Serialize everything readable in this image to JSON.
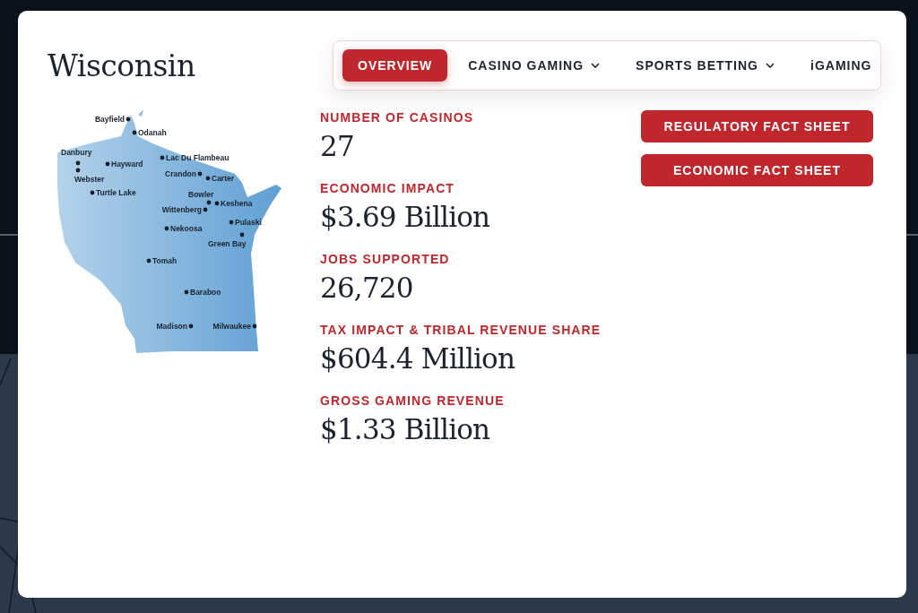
{
  "modal": {
    "title": "Wisconsin",
    "tabs": [
      {
        "label": "OVERVIEW",
        "selected": true,
        "dropdown": false
      },
      {
        "label": "CASINO GAMING",
        "selected": false,
        "dropdown": true
      },
      {
        "label": "SPORTS BETTING",
        "selected": false,
        "dropdown": true
      },
      {
        "label": "iGAMING",
        "selected": false,
        "dropdown": false
      }
    ],
    "map": {
      "cities": [
        "Bayfield",
        "Odanah",
        "Danbury",
        "Webster",
        "Hayward",
        "Turtle Lake",
        "Lac Du Flambeau",
        "Crandon",
        "Carter",
        "Bowler",
        "Keshena",
        "Wittenberg",
        "Pulaski",
        "Green Bay",
        "Nekoosa",
        "Tomah",
        "Baraboo",
        "Madison",
        "Milwaukee"
      ]
    },
    "stats": [
      {
        "label": "NUMBER OF CASINOS",
        "value": "27"
      },
      {
        "label": "ECONOMIC IMPACT",
        "value": "$3.69 Billion"
      },
      {
        "label": "JOBS SUPPORTED",
        "value": "26,720"
      },
      {
        "label": "TAX IMPACT & TRIBAL REVENUE SHARE",
        "value": "$604.4 Million"
      },
      {
        "label": "GROSS GAMING REVENUE",
        "value": "$1.33 Billion"
      }
    ],
    "buttons": [
      "REGULATORY FACT SHEET",
      "ECONOMIC FACT SHEET"
    ]
  }
}
